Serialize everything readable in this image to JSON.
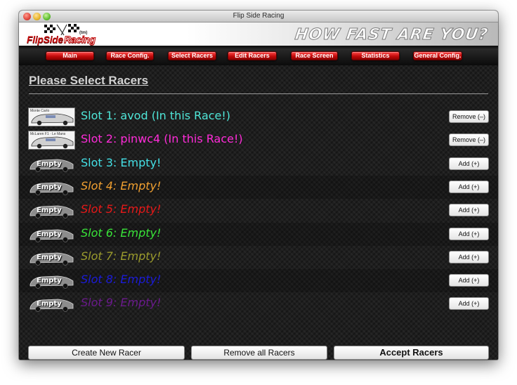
{
  "window": {
    "title": "Flip Side Racing"
  },
  "banner": {
    "logo_text": "FlipSide",
    "logo_text_outline": "Racing",
    "logo_mark": "(tm)",
    "tagline": "HOW FAST ARE YOU?"
  },
  "nav": [
    "Main",
    "Race Config.",
    "Select Racers",
    "Edit Racers",
    "Race Screen",
    "Statistics",
    "General Config."
  ],
  "page": {
    "heading": "Please Select Racers"
  },
  "slots": [
    {
      "label": "Slot 1: avod (In this Race!)",
      "color": "#4fe6d8",
      "italic": false,
      "action": "Remove (–)",
      "thumb_caption": "Monte Carlo",
      "thumb": "car-photo-icon"
    },
    {
      "label": "Slot 2: pinwc4 (In this Race!)",
      "color": "#ff2bd9",
      "italic": false,
      "action": "Remove (–)",
      "thumb_caption": "McLaren F1 · Le Mans",
      "thumb": "car-photo-icon"
    },
    {
      "label": "Slot 3: Empty!",
      "color": "#44e0e6",
      "italic": false,
      "action": "Add (+)",
      "thumb_caption": "Empty",
      "thumb": "empty-car-icon"
    },
    {
      "label": "Slot 4: Empty!",
      "color": "#f0a030",
      "italic": true,
      "action": "Add (+)",
      "thumb_caption": "Empty",
      "thumb": "empty-car-icon"
    },
    {
      "label": "Slot 5: Empty!",
      "color": "#e81818",
      "italic": true,
      "action": "Add (+)",
      "thumb_caption": "Empty",
      "thumb": "empty-car-icon"
    },
    {
      "label": "Slot 6: Empty!",
      "color": "#39e339",
      "italic": true,
      "action": "Add (+)",
      "thumb_caption": "Empty",
      "thumb": "empty-car-icon"
    },
    {
      "label": "Slot 7: Empty!",
      "color": "#9a9a2c",
      "italic": true,
      "action": "Add (+)",
      "thumb_caption": "Empty",
      "thumb": "empty-car-icon"
    },
    {
      "label": "Slot 8: Empty!",
      "color": "#1b1bd8",
      "italic": true,
      "action": "Add (+)",
      "thumb_caption": "Empty",
      "thumb": "empty-car-icon"
    },
    {
      "label": "Slot 9: Empty!",
      "color": "#6a1a8c",
      "italic": true,
      "action": "Add (+)",
      "thumb_caption": "Empty",
      "thumb": "empty-car-icon"
    }
  ],
  "footer": {
    "create": "Create New Racer",
    "remove_all": "Remove all Racers",
    "accept": "Accept Racers"
  },
  "colors": {
    "accent": "#c20a0a",
    "background": "#1e1e1e"
  }
}
